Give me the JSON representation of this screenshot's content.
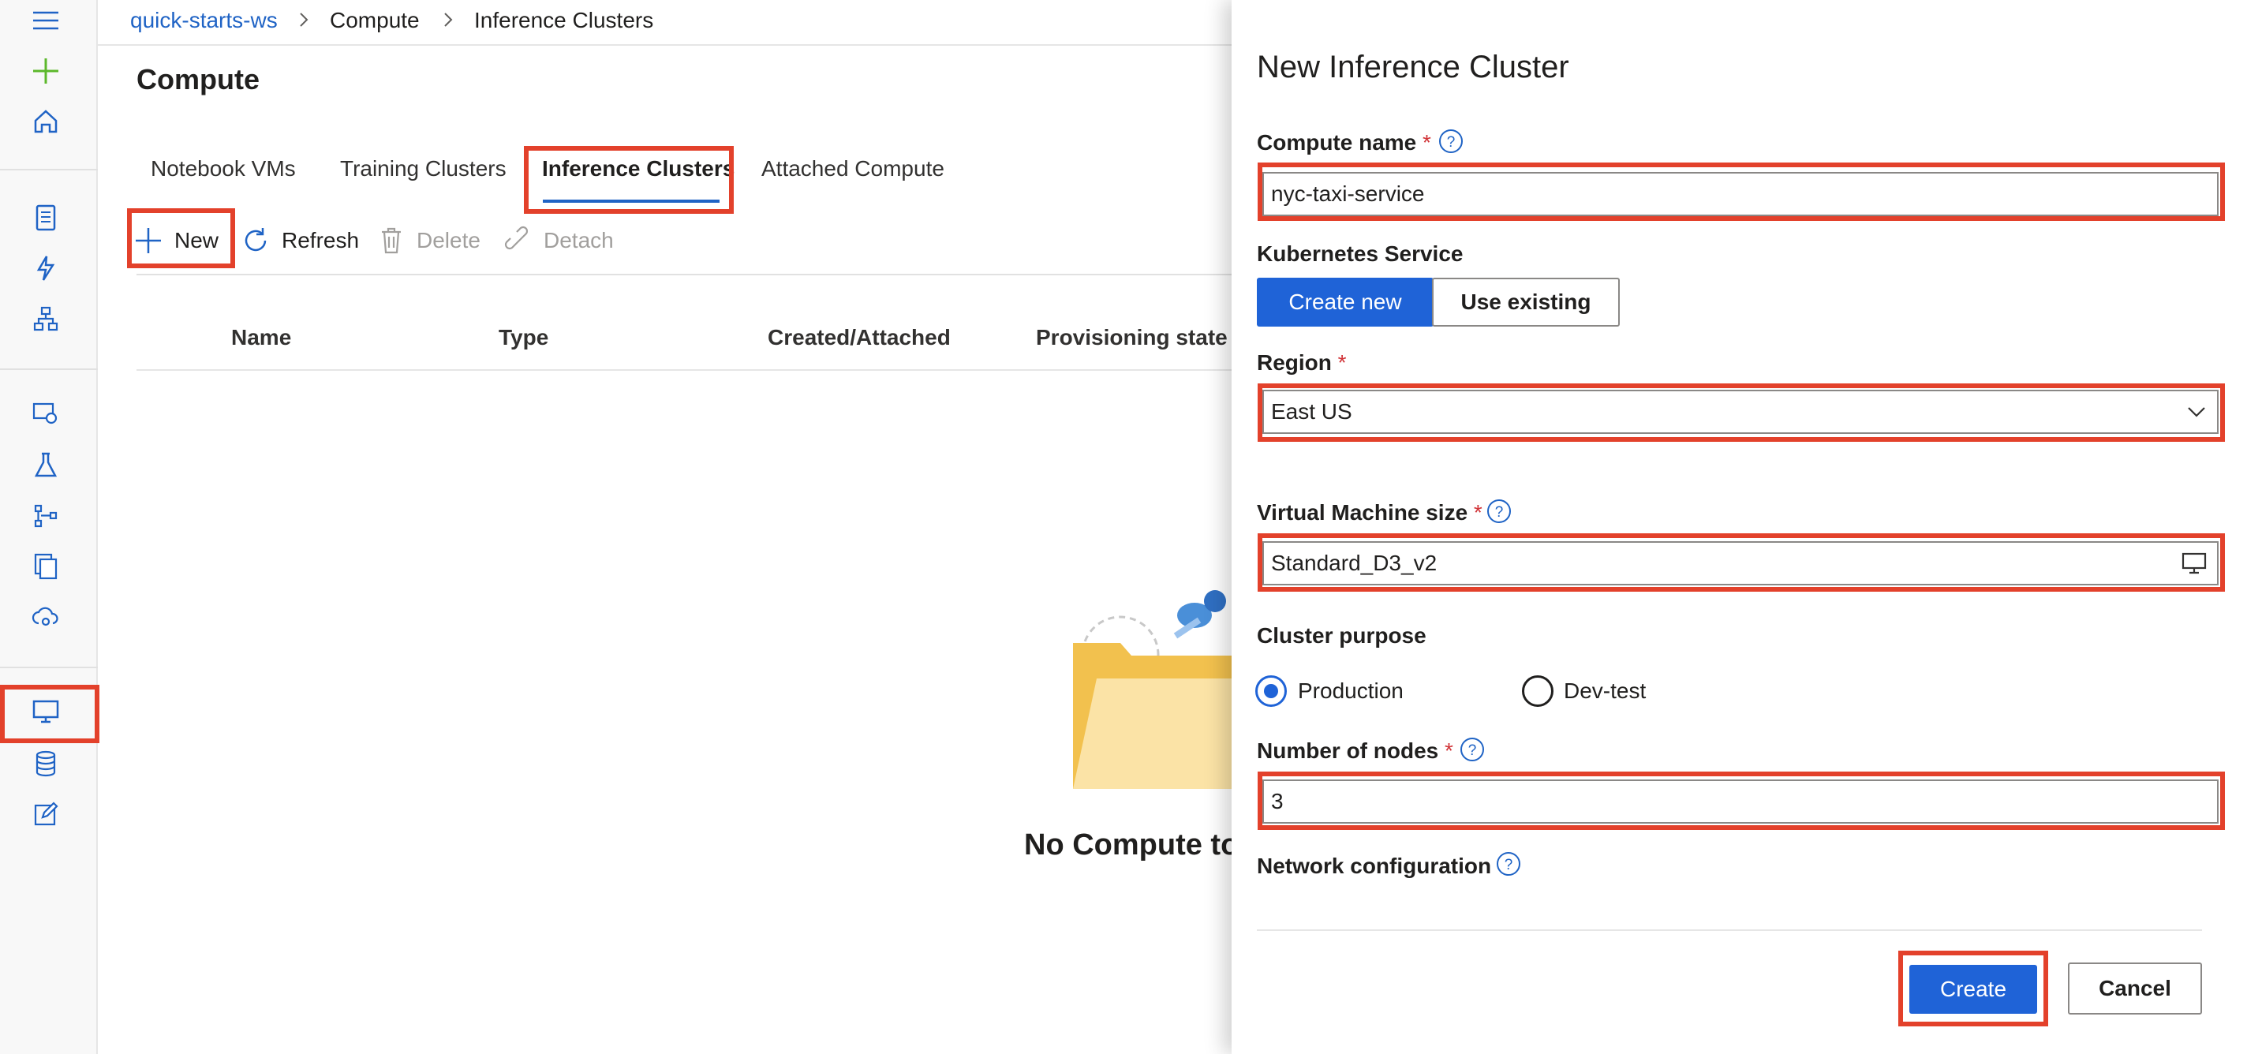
{
  "breadcrumb": {
    "workspace": "quick-starts-ws",
    "section": "Compute",
    "current": "Inference Clusters"
  },
  "page": {
    "title": "Compute"
  },
  "tabs": [
    {
      "label": "Notebook VMs"
    },
    {
      "label": "Training Clusters"
    },
    {
      "label": "Inference Clusters",
      "active": true
    },
    {
      "label": "Attached Compute"
    }
  ],
  "toolbar": {
    "new_label": "New",
    "refresh_label": "Refresh",
    "delete_label": "Delete",
    "detach_label": "Detach"
  },
  "table": {
    "columns": [
      "Name",
      "Type",
      "Created/Attached",
      "Provisioning state"
    ]
  },
  "empty_state": {
    "message": "No Compute to"
  },
  "sidebar": {
    "icons": [
      "menu-icon",
      "plus-icon",
      "home-icon",
      "notebook-icon",
      "automl-icon",
      "designer-icon",
      "datasets-icon",
      "experiments-icon",
      "pipelines-icon",
      "models-icon",
      "endpoints-icon",
      "compute-icon",
      "datastores-icon",
      "labeling-icon"
    ]
  },
  "panel": {
    "title": "New Inference Cluster",
    "compute_name_label": "Compute name",
    "compute_name_value": "nyc-taxi-service",
    "kubernetes_label": "Kubernetes Service",
    "create_new_label": "Create new",
    "use_existing_label": "Use existing",
    "region_label": "Region",
    "region_value": "East US",
    "vm_size_label": "Virtual Machine size",
    "vm_size_value": "Standard_D3_v2",
    "purpose_label": "Cluster purpose",
    "purpose_options": [
      {
        "label": "Production",
        "selected": true
      },
      {
        "label": "Dev-test",
        "selected": false
      }
    ],
    "nodes_label": "Number of nodes",
    "nodes_value": "3",
    "network_label": "Network configuration",
    "create_button": "Create",
    "cancel_button": "Cancel",
    "required_mark": "*"
  },
  "colors": {
    "accent": "#1f63d7",
    "highlight": "#e3412b",
    "link": "#1f63c5"
  }
}
